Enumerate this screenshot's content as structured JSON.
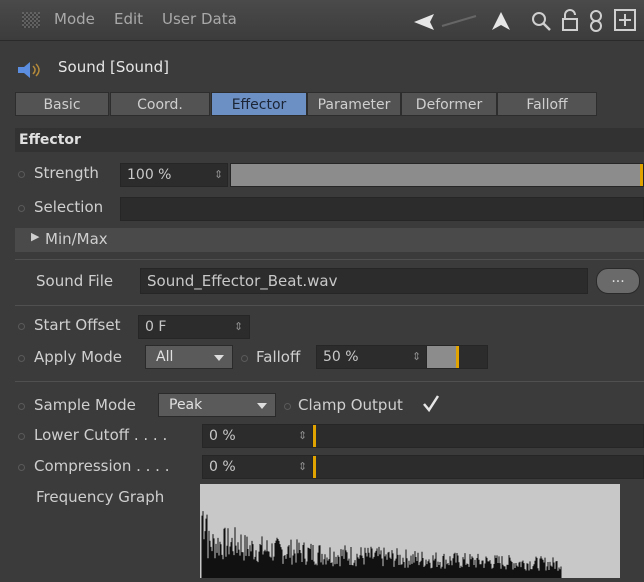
{
  "menubar": {
    "items": [
      "Mode",
      "Edit",
      "User Data"
    ],
    "icons": [
      "grip-icon",
      "back-arrow-icon",
      "pointer-icon",
      "search-icon",
      "lock-icon",
      "link-icon",
      "add-icon"
    ]
  },
  "object": {
    "title": "Sound [Sound]"
  },
  "tabs": [
    {
      "label": "Basic"
    },
    {
      "label": "Coord."
    },
    {
      "label": "Effector",
      "active": true
    },
    {
      "label": "Parameter"
    },
    {
      "label": "Deformer"
    },
    {
      "label": "Falloff"
    }
  ],
  "effector": {
    "section_title": "Effector",
    "strength": {
      "label": "Strength",
      "value": "100 %",
      "fraction": 1.0
    },
    "selection": {
      "label": "Selection",
      "value": ""
    },
    "minmax": {
      "label": "Min/Max"
    }
  },
  "sound": {
    "file_label": "Sound File",
    "file_value": "Sound_Effector_Beat.wav",
    "browse_label": "...",
    "start_offset": {
      "label": "Start Offset",
      "value": "0 F"
    },
    "apply_mode": {
      "label": "Apply Mode",
      "value": "All"
    },
    "falloff": {
      "label": "Falloff",
      "value": "50 %",
      "fraction": 0.5
    },
    "sample_mode": {
      "label": "Sample Mode",
      "value": "Peak"
    },
    "clamp_output": {
      "label": "Clamp Output",
      "checked": true
    },
    "lower_cutoff": {
      "label": "Lower Cutoff . . . .",
      "value": "0 %",
      "fraction": 0
    },
    "compression": {
      "label": "Compression . . . .",
      "value": "0 %",
      "fraction": 0
    },
    "graph_label": "Frequency Graph"
  },
  "colors": {
    "accent": "#6c8fc4",
    "slider_marker": "#e1a300",
    "panel": "#3b3b3b"
  }
}
